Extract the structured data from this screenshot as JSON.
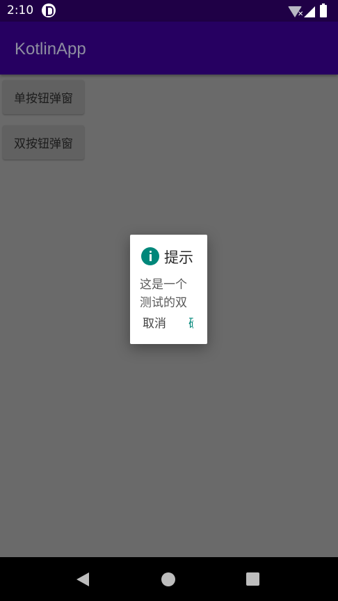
{
  "status_bar": {
    "time": "2:10",
    "icons": [
      "app-notification-icon",
      "wifi-off-icon",
      "cell-signal-icon",
      "battery-icon"
    ]
  },
  "app_bar": {
    "title": "KotlinApp"
  },
  "buttons": {
    "single": "单按钮弹窗",
    "double": "双按钮弹窗"
  },
  "dialog": {
    "icon": "info-icon",
    "title": "提示",
    "message": "这是一个测试的双",
    "cancel": "取消",
    "confirm": "确"
  },
  "nav_bar": {
    "icons": [
      "back-icon",
      "home-icon",
      "recents-icon"
    ]
  },
  "colors": {
    "status_bar": "#1f0046",
    "app_bar": "#260061",
    "scrim": "#6a6a6a",
    "accent": "#00877a"
  }
}
